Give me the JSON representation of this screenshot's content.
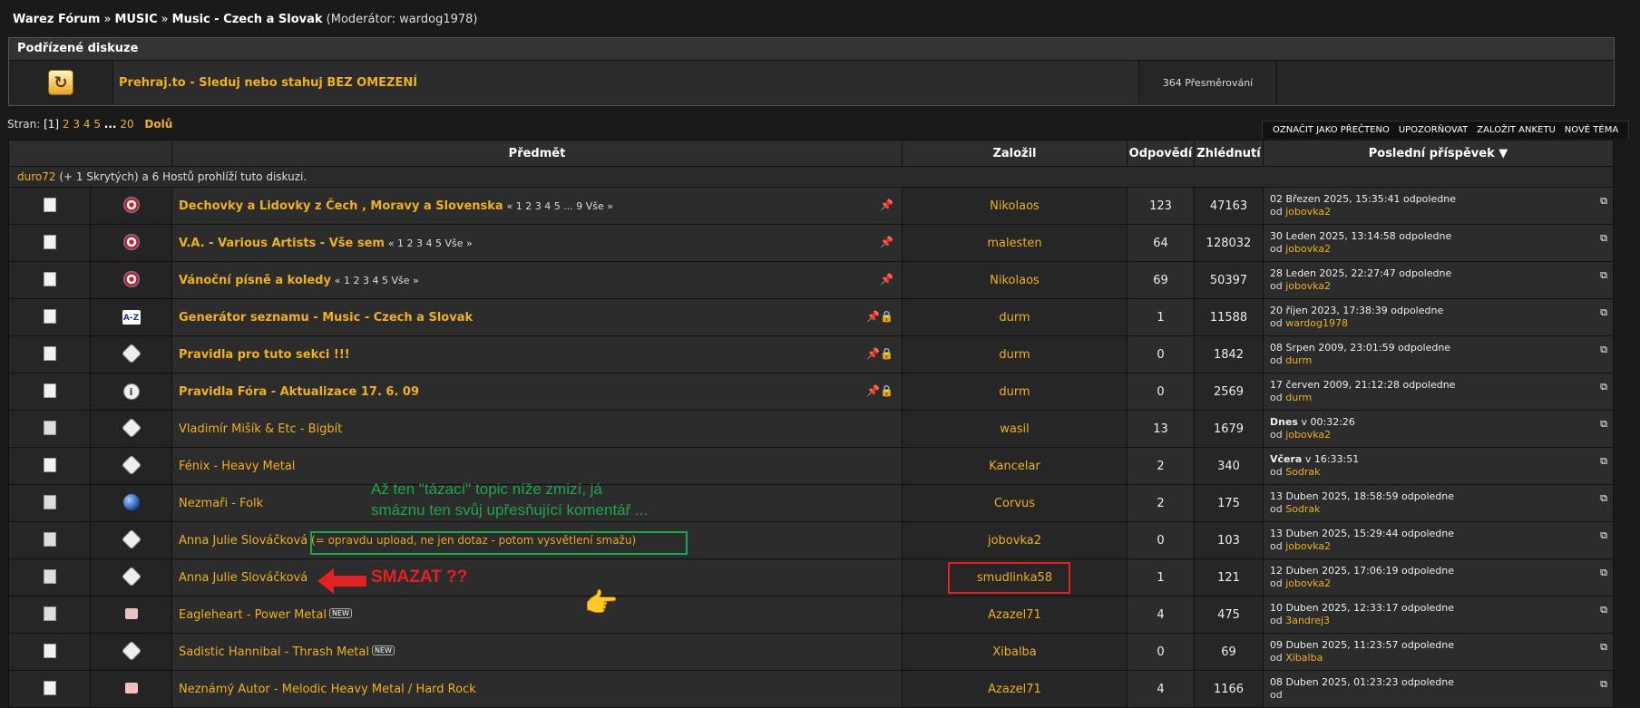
{
  "breadcrumb": {
    "root": "Warez Fórum",
    "sep": "»",
    "music": "MUSIC",
    "board": "Music - Czech a Slovak",
    "moderator": "(Moderátor: wardog1978)"
  },
  "subforums": {
    "title": "Podřízené diskuze",
    "item": {
      "icon": "redirect-icon",
      "name": "Prehraj.to - Sleduj nebo stahuj BEZ OMEZENÍ",
      "redirects": "364 Přesměrování"
    }
  },
  "pagination": {
    "label": "Stran:",
    "current": "[1]",
    "pages": [
      "2",
      "3",
      "4",
      "5"
    ],
    "gap": "...",
    "last": "20",
    "down": "Dolů"
  },
  "toolbar": {
    "mark_read": "OZNAČIT JAKO PŘEČTENO",
    "notify": "UPOZORŇOVAT",
    "new_poll": "ZALOŽIT ANKETU",
    "new_topic": "NOVÉ TÉMA"
  },
  "table": {
    "headers": {
      "subject": "Předmět",
      "started_by": "Založil",
      "replies": "Odpovědí",
      "views": "Zhlédnutí",
      "last_post": "Poslední příspěvek ▼"
    },
    "viewers": {
      "user": "duro72",
      "rest": "(+ 1 Skrytých) a 6 Hostů prohlíží tuto diskuzi."
    },
    "rows": [
      {
        "subject": "Dechovky a Lidovky z Čech , Moravy a Slovenska",
        "pages": "« 1 2 3 4 5 ... 9  Vše »",
        "author": "Nikolaos",
        "replies": "123",
        "views": "47163",
        "last_date": "02 Březen 2025, 15:35:41 odpoledne",
        "last_by": "jobovka2",
        "flags": "📌"
      },
      {
        "subject": "V.A. - Various Artists - Vše sem",
        "pages": "« 1 2 3 4 5  Vše »",
        "author": "malesten",
        "replies": "64",
        "views": "128032",
        "last_date": "30 Leden 2025, 13:14:58 odpoledne",
        "last_by": "jobovka2",
        "flags": "📌"
      },
      {
        "subject": "Vánoční písně a koledy",
        "pages": "« 1 2 3 4 5  Vše »",
        "author": "Nikolaos",
        "replies": "69",
        "views": "50397",
        "last_date": "28 Leden 2025, 22:27:47 odpoledne",
        "last_by": "jobovka2",
        "flags": "📌"
      },
      {
        "subject": "Generátor seznamu - Music - Czech a Slovak",
        "pages": "",
        "author": "durm",
        "replies": "1",
        "views": "11588",
        "last_date": "20 říjen 2023, 17:38:39 odpoledne",
        "last_by": "wardog1978",
        "flags": "📌🔒"
      },
      {
        "subject": "Pravidla pro tuto sekci !!!",
        "pages": "",
        "author": "durm",
        "replies": "0",
        "views": "1842",
        "last_date": "08 Srpen 2009, 23:01:59 odpoledne",
        "last_by": "durm",
        "flags": "📌🔒"
      },
      {
        "subject": "Pravidla Fóra - Aktualizace 17. 6. 09",
        "pages": "",
        "author": "durm",
        "replies": "0",
        "views": "2569",
        "last_date": "17 červen 2009, 21:12:28 odpoledne",
        "last_by": "durm",
        "flags": "📌🔒"
      },
      {
        "subject": "Vladimír Mišík & Etc - Bigbít",
        "pages": "",
        "author": "wasil",
        "replies": "13",
        "views": "1679",
        "last_date_bold": "Dnes",
        "last_date": " v 00:32:26",
        "last_by": "jobovka2",
        "flags": ""
      },
      {
        "subject": "Fénix - Heavy Metal",
        "pages": "",
        "author": "Kancelar",
        "replies": "2",
        "views": "340",
        "last_date_bold": "Včera",
        "last_date": " v 16:33:51",
        "last_by": "Sodrak",
        "flags": ""
      },
      {
        "subject": "Nezmaři - Folk",
        "pages": "",
        "author": "Corvus",
        "replies": "2",
        "views": "175",
        "last_date": "13 Duben 2025, 18:58:59 odpoledne",
        "last_by": "Sodrak",
        "flags": ""
      },
      {
        "subject": "Anna Julie Slováčková",
        "note": "(= opravdu upload, ne jen dotaz - potom vysvětlení smažu)",
        "pages": "",
        "author": "jobovka2",
        "replies": "0",
        "views": "103",
        "last_date": "13 Duben 2025, 15:29:44 odpoledne",
        "last_by": "jobovka2",
        "flags": ""
      },
      {
        "subject": "Anna Julie Slováčková",
        "pages": "",
        "author": "smudlinka58",
        "replies": "1",
        "views": "121",
        "last_date": "12 Duben 2025, 17:06:19 odpoledne",
        "last_by": "jobovka2",
        "flags": ""
      },
      {
        "subject": "Eagleheart - Power Metal",
        "pages": "",
        "badge": "NEW",
        "author": "Azazel71",
        "replies": "4",
        "views": "475",
        "last_date": "10 Duben 2025, 12:33:17 odpoledne",
        "last_by": "3andrej3",
        "flags": ""
      },
      {
        "subject": "Sadistic Hannibal - Thrash Metal",
        "pages": "",
        "badge": "NEW",
        "author": "Xibalba",
        "replies": "0",
        "views": "69",
        "last_date": "09 Duben 2025, 11:23:57 odpoledne",
        "last_by": "Xibalba",
        "flags": ""
      },
      {
        "subject": "Neznámý Autor - Melodic Heavy Metal / Hard Rock",
        "pages": "",
        "author": "Azazel71",
        "replies": "4",
        "views": "1166",
        "last_date": "08 Duben 2025, 01:23:23 odpoledne",
        "last_by": "",
        "flags": ""
      }
    ],
    "by_label": "od",
    "go_icon": "go-to-last-post-icon"
  },
  "annotations": {
    "green_text_1": "Až ten \"tázací\" topic níže zmizí, já",
    "green_text_2": "smáznu ten svůj upřesňující komentář ...",
    "red_text": "SMAZAT ??",
    "colors": {
      "green": "#1ea64a",
      "red": "#e22222",
      "link": "#f0b020"
    }
  }
}
